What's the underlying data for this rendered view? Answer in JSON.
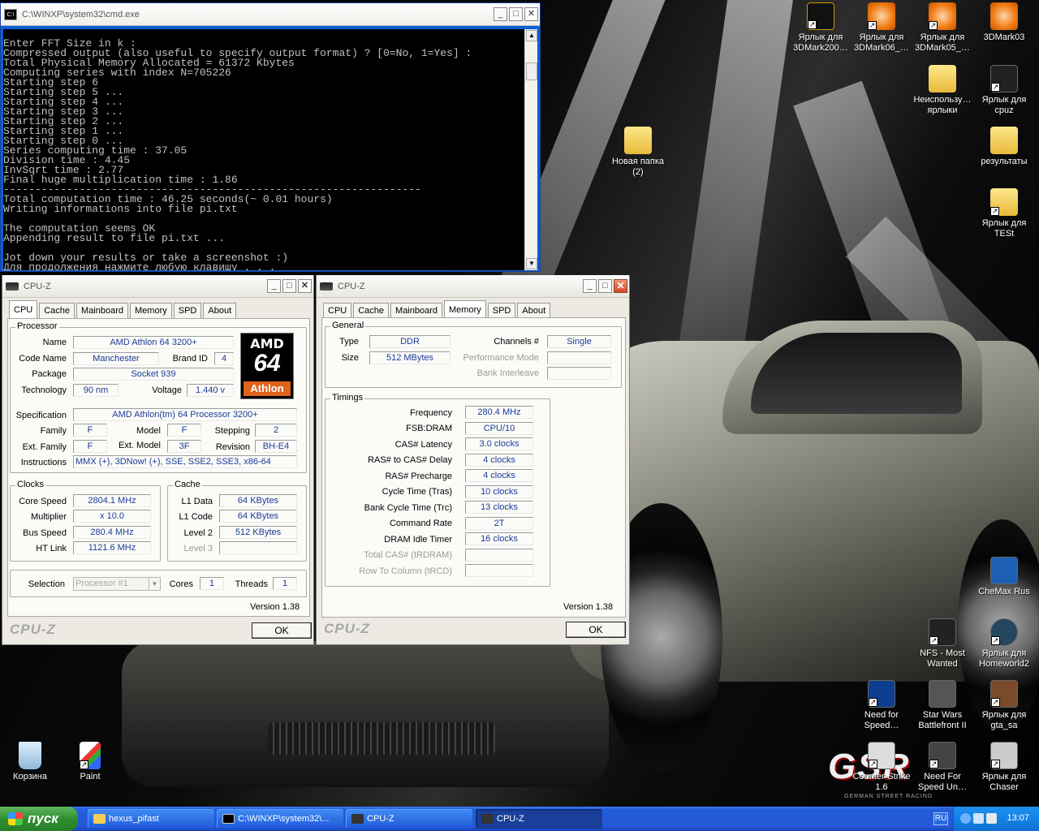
{
  "desktop": {
    "icons": [
      {
        "label": "Ярлык для 3DMark200…",
        "kind": "dark"
      },
      {
        "label": "Ярлык для 3DMark06_…",
        "kind": "m3d"
      },
      {
        "label": "Ярлык для 3DMark05_…",
        "kind": "m3d"
      },
      {
        "label": "3DMark03",
        "kind": "m3d"
      },
      {
        "label": "Неиспользу… ярлыки",
        "kind": "folder"
      },
      {
        "label": "Ярлык для cpuz",
        "kind": "dark"
      },
      {
        "label": "Новая папка (2)",
        "kind": "folder"
      },
      {
        "label": "результаты",
        "kind": "folder"
      },
      {
        "label": "Ярлык для TESt",
        "kind": "folder"
      },
      {
        "label": "CheMax Rus",
        "kind": "dark"
      },
      {
        "label": "NFS - Most Wanted",
        "kind": "dark"
      },
      {
        "label": "Ярлык для Homeworld2",
        "kind": "dark"
      },
      {
        "label": "Need for Speed…",
        "kind": "dark"
      },
      {
        "label": "Star Wars Battlefront II",
        "kind": "dark"
      },
      {
        "label": "Ярлык для gta_sa",
        "kind": "dark"
      },
      {
        "label": "Counter-Strike 1.6",
        "kind": "dark"
      },
      {
        "label": "Need For Speed Un…",
        "kind": "dark"
      },
      {
        "label": "Ярлык для Chaser",
        "kind": "dark"
      },
      {
        "label": "Корзина",
        "kind": "dark"
      },
      {
        "label": "Paint",
        "kind": "dark"
      }
    ],
    "wallpaper_logo": "GSR",
    "wallpaper_tagline": "GERMAN STREET RACING"
  },
  "cmd": {
    "title": "C:\\WINXP\\system32\\cmd.exe",
    "icon_text": "C:\\",
    "lines": [
      "Enter FFT Size in k :",
      "Compressed output (also useful to specify output format) ? [0=No, 1=Yes] :",
      "Total Physical Memory Allocated = 61372 Kbytes",
      "Computing series with index N=705226",
      "Starting step 6",
      "Starting step 5 ...",
      "Starting step 4 ...",
      "Starting step 3 ...",
      "Starting step 2 ...",
      "Starting step 1 ...",
      "Starting step 0 ...",
      "Series computing time : 37.05",
      "Division time : 4.45",
      "InvSqrt time : 2.77",
      "Final huge multiplication time : 1.86",
      "------------------------------------------------------------------",
      "Total computation time : 46.25 seconds(~ 0.01 hours)",
      "Writing informations into file pi.txt",
      "",
      "The computation seems OK",
      "Appending result to file pi.txt ...",
      "",
      "Jot down your results or take a screenshot :)",
      "Для продолжения нажмите любую клавишу . . ."
    ]
  },
  "win_buttons": {
    "minimize": "_",
    "maximize": "□",
    "close": "✕"
  },
  "cpuz_tabs": [
    "CPU",
    "Cache",
    "Mainboard",
    "Memory",
    "SPD",
    "About"
  ],
  "cpuz_cpu": {
    "title": "CPU-Z",
    "processor_group": "Processor",
    "name_label": "Name",
    "name": "AMD Athlon 64 3200+",
    "codename_label": "Code Name",
    "codename": "Manchester",
    "brandid_label": "Brand ID",
    "brandid": "4",
    "package_label": "Package",
    "package": "Socket 939",
    "technology_label": "Technology",
    "technology": "90 nm",
    "voltage_label": "Voltage",
    "voltage": "1.440 v",
    "spec_label": "Specification",
    "spec": "AMD Athlon(tm) 64 Processor 3200+",
    "family_label": "Family",
    "family": "F",
    "model_label": "Model",
    "model": "F",
    "stepping_label": "Stepping",
    "stepping": "2",
    "extfamily_label": "Ext. Family",
    "extfamily": "F",
    "extmodel_label": "Ext. Model",
    "extmodel": "3F",
    "revision_label": "Revision",
    "revision": "BH-E4",
    "instructions_label": "Instructions",
    "instructions": "MMX (+), 3DNow! (+), SSE, SSE2, SSE3, x86-64",
    "logo": {
      "brand": "AMD",
      "model": "64",
      "line": "Athlon"
    },
    "clocks_group": "Clocks",
    "corespeed_label": "Core Speed",
    "corespeed": "2804.1 MHz",
    "multiplier_label": "Multiplier",
    "multiplier": "x 10.0",
    "busspeed_label": "Bus Speed",
    "busspeed": "280.4 MHz",
    "htlink_label": "HT Link",
    "htlink": "1121.6 MHz",
    "cache_group": "Cache",
    "l1data_label": "L1 Data",
    "l1data": "64 KBytes",
    "l1code_label": "L1 Code",
    "l1code": "64 KBytes",
    "level2_label": "Level 2",
    "level2": "512 KBytes",
    "level3_label": "Level 3",
    "selection_label": "Selection",
    "selection": "Processor #1",
    "cores_label": "Cores",
    "cores": "1",
    "threads_label": "Threads",
    "threads": "1",
    "version": "Version 1.38",
    "brand": "CPU-Z",
    "ok": "OK"
  },
  "cpuz_mem": {
    "title": "CPU-Z",
    "general_group": "General",
    "type_label": "Type",
    "type": "DDR",
    "size_label": "Size",
    "size": "512 MBytes",
    "channels_label": "Channels #",
    "channels": "Single",
    "perfmode_label": "Performance Mode",
    "bank_label": "Bank Interleave",
    "timings_group": "Timings",
    "frequency_label": "Frequency",
    "frequency": "280.4 MHz",
    "fsbdram_label": "FSB:DRAM",
    "fsbdram": "CPU/10",
    "cas_label": "CAS# Latency",
    "cas": "3.0 clocks",
    "rcd_label": "RAS# to CAS# Delay",
    "rcd": "4 clocks",
    "rp_label": "RAS# Precharge",
    "rp": "4 clocks",
    "tras_label": "Cycle Time (Tras)",
    "tras": "10 clocks",
    "trc_label": "Bank Cycle Time (Trc)",
    "trc": "13 clocks",
    "cr_label": "Command Rate",
    "cr": "2T",
    "idle_label": "DRAM Idle Timer",
    "idle": "16 clocks",
    "trdram_label": "Total CAS# (tRDRAM)",
    "trcd_label": "Row To Column (tRCD)",
    "version": "Version 1.38",
    "brand": "CPU-Z",
    "ok": "OK"
  },
  "taskbar": {
    "start": "пуск",
    "tasks": [
      "hexus_pifast",
      "C:\\WINXP\\system32\\...",
      "CPU-Z",
      "CPU-Z"
    ],
    "lang": "RU",
    "clock": "13:07"
  }
}
